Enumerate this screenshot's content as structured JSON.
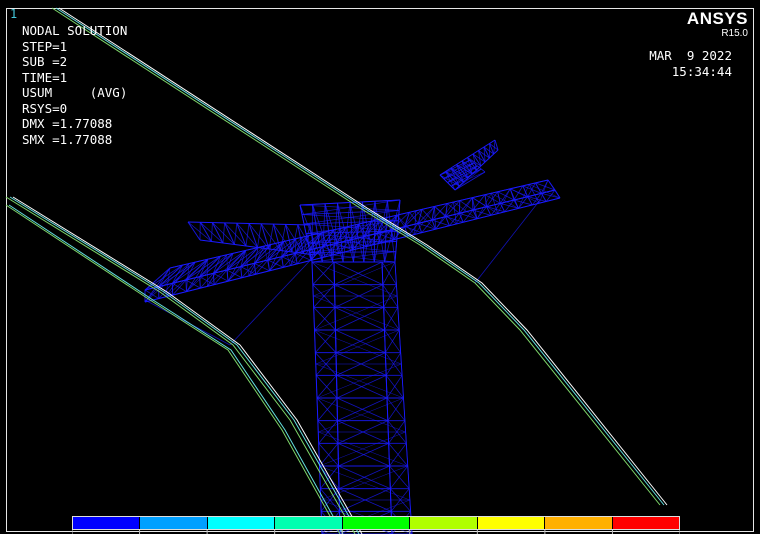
{
  "window": {
    "number": "1"
  },
  "header": {
    "title": "NODAL SOLUTION",
    "lines": [
      "STEP=1",
      "SUB =2",
      "TIME=1",
      "USUM     (AVG)",
      "RSYS=0",
      "DMX =1.77088",
      "SMX =1.77088"
    ]
  },
  "brand": {
    "name": "ANSYS",
    "version": "R15.0"
  },
  "stamp": {
    "date": "MAR  9 2022",
    "time": "15:34:44"
  },
  "model": {
    "mesh_color": "#1a1aff",
    "cable_colors": [
      "#7fd86a",
      "#63e0e0",
      "#ffffff"
    ]
  },
  "legend": {
    "colors": [
      "#0000ff",
      "#00a0ff",
      "#00ffff",
      "#00ffb0",
      "#00ff00",
      "#b0ff00",
      "#ffff00",
      "#ffb000",
      "#ff0000"
    ]
  },
  "icons": {
    "legend": "contour-color-scale"
  }
}
